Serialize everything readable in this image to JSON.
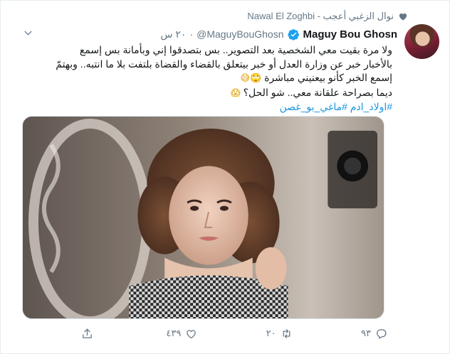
{
  "social_context": {
    "text": "Nawal El Zoghbi - نوال الزغبي أعجب",
    "icon": "heart-icon"
  },
  "author": {
    "display_name": "Maguy Bou Ghosn",
    "handle": "@MaguyBouGhosn",
    "verified": true,
    "time": "٢٠ س"
  },
  "tweet": {
    "lines": [
      "ولا مرة بقيت معي الشخصية بعد التصوير.. بس بتصدقوا إني وبأمانة بس إسمع",
      "بالأخبار خبر عن وزارة العدل أو خبر بيتعلق بالقضاء والقضاة بلتفت بلا ما انتبه.. وبهتمّ",
      "إسمع الخبر كأنو بيعنيني مباشرة",
      "ديما بصراحة علقانة معي.. شو الحل؟"
    ],
    "emoji_line3": "🙄😅",
    "emoji_line4": "😱",
    "hashtags": "#اولاد_ادم #ماغي_بو_غصن"
  },
  "actions": {
    "reply_count": "٩٣",
    "retweet_count": "٢٠",
    "like_count": "٤٣٩",
    "share_label": ""
  },
  "colors": {
    "link": "#1b95e0",
    "muted": "#657786",
    "verified": "#1da1f2"
  }
}
